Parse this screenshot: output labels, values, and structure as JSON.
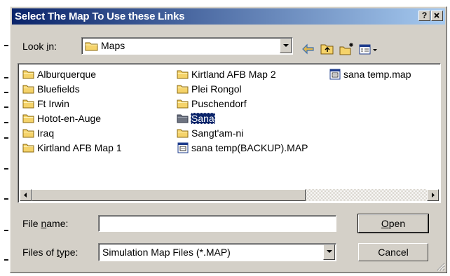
{
  "dialog": {
    "title": "Select The Map To Use these Links",
    "help_label": "?",
    "close_label": "x"
  },
  "lookin": {
    "label_pre": "Look ",
    "label_key": "i",
    "label_post": "n:",
    "value": "Maps",
    "value_icon": "folder-icon"
  },
  "toolbar": {
    "icons": [
      "back-arrow-icon",
      "up-folder-icon",
      "new-folder-icon",
      "view-menu-icon"
    ]
  },
  "files": {
    "columns": [
      [
        {
          "name": "Alburquerque",
          "icon": "folder-icon"
        },
        {
          "name": "Bluefields",
          "icon": "folder-icon"
        },
        {
          "name": "Ft Irwin",
          "icon": "folder-icon"
        },
        {
          "name": "Hotot-en-Auge",
          "icon": "folder-icon"
        },
        {
          "name": "Iraq",
          "icon": "folder-icon"
        },
        {
          "name": "Kirtland AFB Map 1",
          "icon": "folder-icon"
        }
      ],
      [
        {
          "name": "Kirtland AFB Map 2",
          "icon": "folder-icon"
        },
        {
          "name": "Plei Rongol",
          "icon": "folder-icon"
        },
        {
          "name": "Puschendorf",
          "icon": "folder-icon"
        },
        {
          "name": "Sana",
          "icon": "folder-icon",
          "selected": true
        },
        {
          "name": "Sangt'am-ni",
          "icon": "folder-icon"
        },
        {
          "name": "sana temp(BACKUP).MAP",
          "icon": "map-file-icon"
        }
      ],
      [
        {
          "name": "sana temp.map",
          "icon": "map-file-icon"
        }
      ]
    ]
  },
  "filename": {
    "label_pre": "File ",
    "label_key": "n",
    "label_post": "ame:",
    "value": ""
  },
  "filetype": {
    "label_pre": "Files of ",
    "label_key": "t",
    "label_post": "ype:",
    "value": "Simulation Map Files (*.MAP)"
  },
  "buttons": {
    "open_key": "O",
    "open_rest": "pen",
    "cancel": "Cancel"
  },
  "colors": {
    "title_start": "#0a246a",
    "title_end": "#a6caf0",
    "face": "#d4d0c8",
    "folder": "#f5d36a",
    "selection": "#0a246a"
  }
}
